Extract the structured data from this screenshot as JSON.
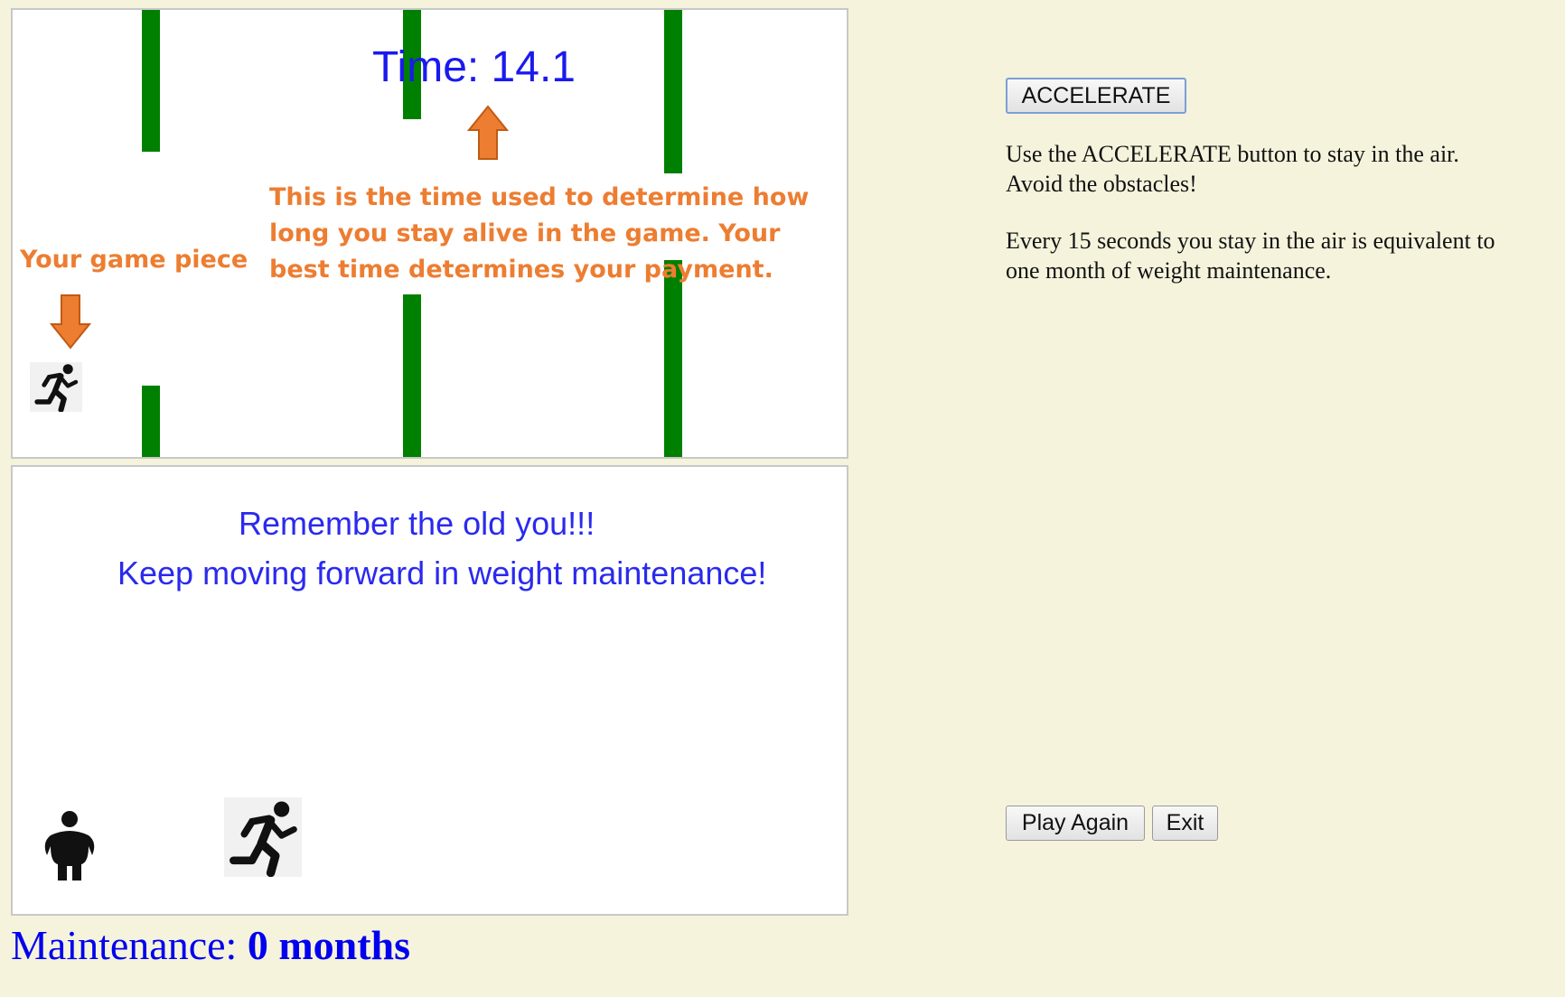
{
  "game": {
    "time_label": "Time: 14.1",
    "annotations": {
      "game_piece": "Your game piece",
      "time_note": "This is the time used to determine how long you stay alive in the game.  Your best time determines your payment."
    }
  },
  "message": {
    "line1": "Remember the old you!!!",
    "line2": "Keep moving forward in weight maintenance!"
  },
  "maintenance": {
    "label": "Maintenance:",
    "value": "0 months"
  },
  "controls": {
    "accelerate_label": "ACCELERATE",
    "play_again_label": "Play Again",
    "exit_label": "Exit"
  },
  "instructions": {
    "p1": "Use the ACCELERATE button to stay in the air. Avoid the obstacles!",
    "p2": "Every 15 seconds you stay in the air is equivalent to one month of weight maintenance."
  },
  "colors": {
    "pipe": "#008000",
    "annotation": "#ed7d31",
    "time_text": "#1a1aee",
    "maintenance_text": "#0000ee",
    "page_bg": "#f5f3dc"
  },
  "icons": [
    "runner-icon",
    "up-arrow-icon",
    "down-arrow-icon",
    "standing-person-icon"
  ]
}
